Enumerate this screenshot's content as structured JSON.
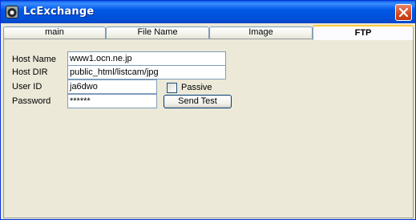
{
  "window": {
    "title": "LcExchange"
  },
  "tabs": [
    {
      "label": "main"
    },
    {
      "label": "File Name"
    },
    {
      "label": "Image"
    },
    {
      "label": "FTP"
    }
  ],
  "ftp": {
    "host_name": {
      "label": "Host Name",
      "value": "www1.ocn.ne.jp"
    },
    "host_dir": {
      "label": "Host DIR",
      "value": "public_html/listcam/jpg"
    },
    "user_id": {
      "label": "User ID",
      "value": "ja6dwo"
    },
    "password": {
      "label": "Password",
      "value": "******"
    },
    "passive": {
      "label": "Passive",
      "checked": false
    },
    "send_test": {
      "label": "Send Test"
    }
  },
  "colors": {
    "titlebar": "#0054E3",
    "close": "#D2471F",
    "face": "#ECE9D8"
  }
}
